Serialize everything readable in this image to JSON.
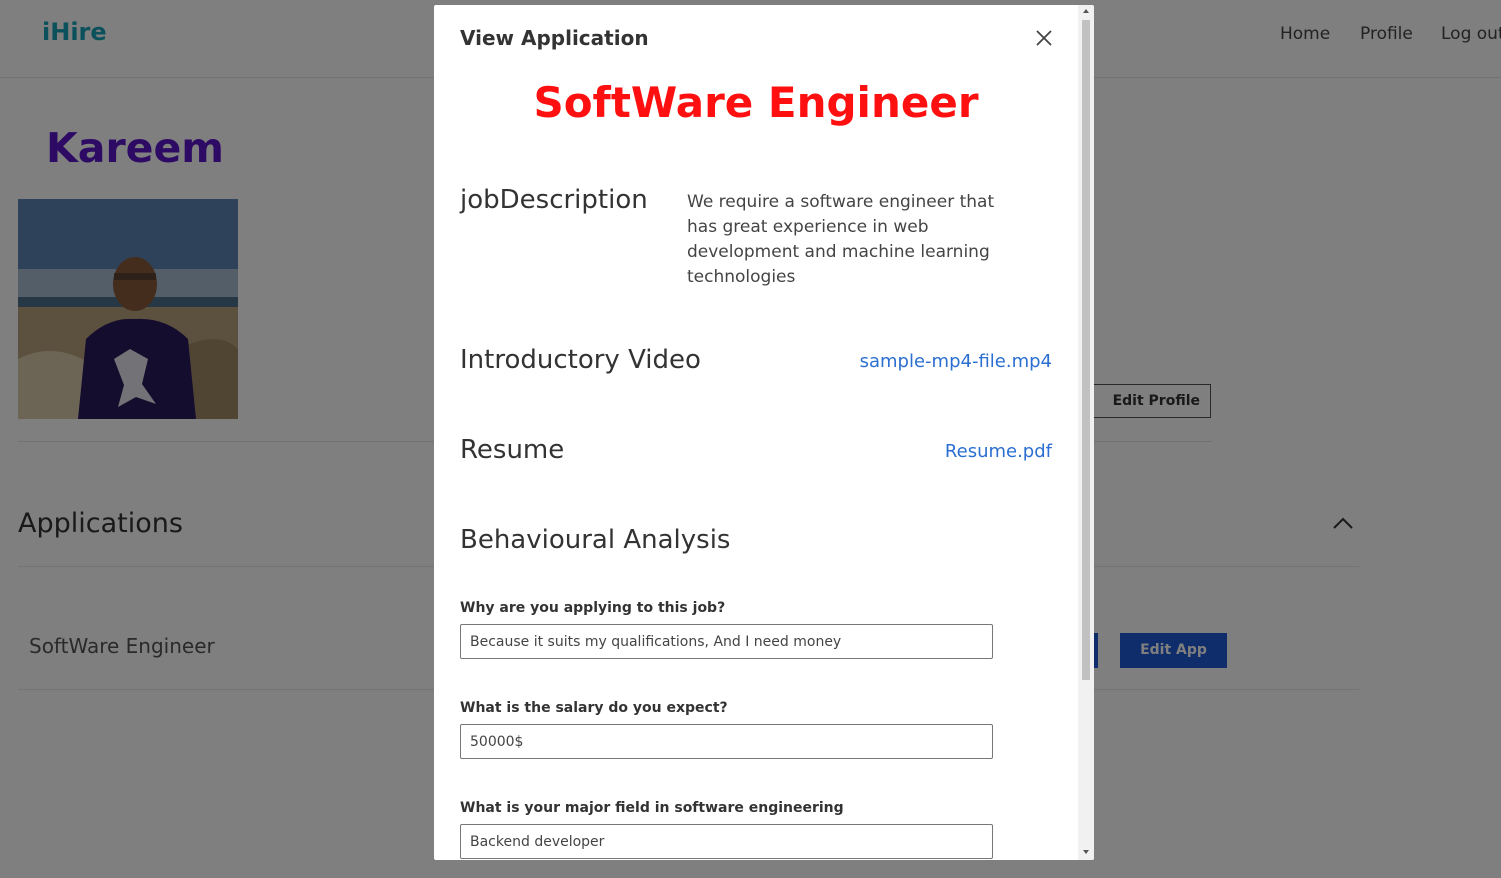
{
  "navbar": {
    "brand": "iHire",
    "links": {
      "home": "Home",
      "profile": "Profile",
      "logout": "Log out"
    }
  },
  "profile": {
    "name": "Kareem",
    "edit_profile_label": "Edit Profile"
  },
  "applications": {
    "title": "Applications",
    "items": [
      {
        "title": "SoftWare Engineer",
        "edit_label": "Edit App"
      }
    ]
  },
  "modal": {
    "header_title": "View Application",
    "job_title": "SoftWare Engineer",
    "job_description_label": "jobDescription",
    "job_description": "We require a software engineer that has great experience in web development and machine learning technologies",
    "intro_video_label": "Introductory Video",
    "intro_video_file": "sample-mp4-file.mp4",
    "resume_label": "Resume",
    "resume_file": "Resume.pdf",
    "behavioural_label": "Behavioural Analysis",
    "questions": [
      {
        "label": "Why are you applying to this job?",
        "value": "Because it suits my qualifications, And I need money"
      },
      {
        "label": "What is the salary do you expect?",
        "value": "50000$"
      },
      {
        "label": "What is your major field in software engineering",
        "value": "Backend developer"
      }
    ]
  },
  "colors": {
    "brand": "#17a2b8",
    "user_name": "#5a14c8",
    "job_title": "#ff1010",
    "link": "#2b6fd1",
    "primary_button": "#1f5ad6"
  }
}
